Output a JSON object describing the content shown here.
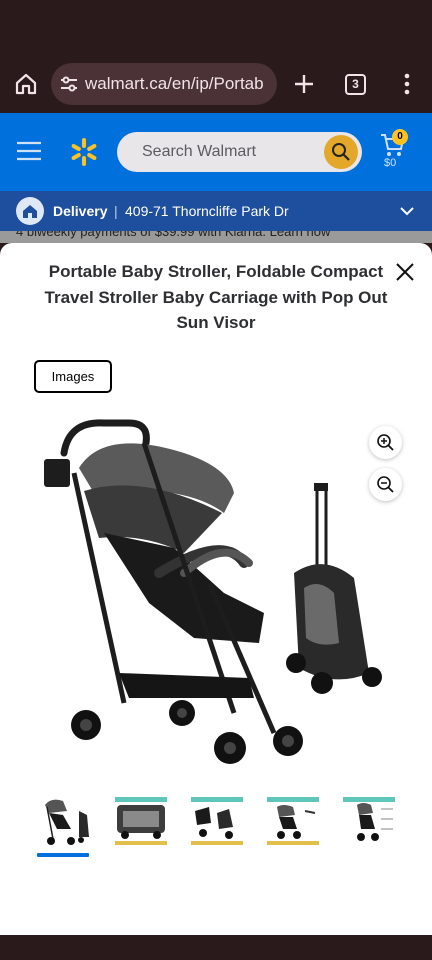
{
  "browser": {
    "url": "walmart.ca/en/ip/Portab",
    "tab_count": "3"
  },
  "header": {
    "search_placeholder": "Search Walmart",
    "cart_badge": "0",
    "cart_amount": "$0",
    "brand_color": "#0071dc"
  },
  "delivery": {
    "label": "Delivery",
    "separator": "|",
    "address": "409-71 Thorncliffe Park Dr"
  },
  "peek_text": "4 biweekly payments of $39.99 with Klarna. Learn how",
  "modal": {
    "title": "Portable Baby Stroller, Foldable Compact Travel Stroller Baby Carriage with Pop Out Sun Visor",
    "images_tab": "Images",
    "selected_thumb": 1,
    "thumb_count": 5
  },
  "icons": [
    "home-icon",
    "tune-icon",
    "plus-icon",
    "kebab-icon",
    "menu-icon",
    "spark-logo-icon",
    "search-icon",
    "cart-icon",
    "house-icon",
    "chevron-down-icon",
    "close-icon",
    "zoom-in-icon",
    "zoom-out-icon"
  ]
}
